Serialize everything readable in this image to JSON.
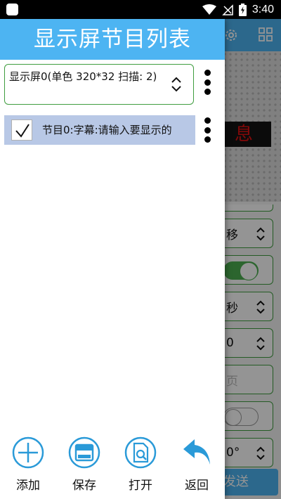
{
  "status_bar": {
    "time": "3:40"
  },
  "drawer": {
    "title": "显示屏节目列表",
    "screen_select": {
      "value": "显示屏0(单色 320*32 扫描: 2)"
    },
    "programs": [
      {
        "label": "节目0:字幕:请输入要显示的",
        "checked": true
      }
    ],
    "toolbar": [
      {
        "name": "add",
        "label": "添加",
        "icon": "plus-circle-icon"
      },
      {
        "name": "save",
        "label": "保存",
        "icon": "save-icon"
      },
      {
        "name": "open",
        "label": "打开",
        "icon": "open-file-icon"
      },
      {
        "name": "back",
        "label": "返回",
        "icon": "back-arrow-icon"
      }
    ]
  },
  "background": {
    "led_text": "息",
    "rows": [
      "移",
      "",
      "秒",
      "0",
      "页",
      "",
      "0°"
    ],
    "send_label": "发送"
  },
  "colors": {
    "accent": "#4db4f2",
    "border_green": "#3f9d3f",
    "selection": "#b8c8e6",
    "led_red": "#e01010"
  }
}
